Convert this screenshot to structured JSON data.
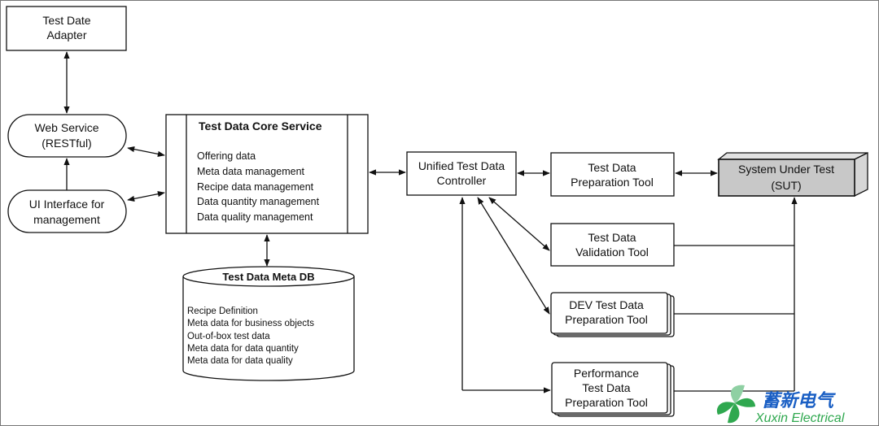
{
  "nodes": {
    "adapter": {
      "lines": [
        "Test Date",
        "Adapter"
      ]
    },
    "web_service": {
      "lines": [
        "Web Service",
        "(RESTful)"
      ]
    },
    "ui_interface": {
      "lines": [
        "UI Interface for",
        "management"
      ]
    },
    "core_service": {
      "title": "Test Data Core Service",
      "items": [
        "Offering data",
        "Meta data management",
        "Recipe data management",
        "Data quantity management",
        "Data quality management"
      ]
    },
    "meta_db": {
      "title": "Test Data Meta DB",
      "items": [
        "Recipe Definition",
        "Meta data for business objects",
        "Out-of-box test data",
        "Meta data for data quantity",
        "Meta data for data quality"
      ]
    },
    "controller": {
      "lines": [
        "Unified Test Data",
        "Controller"
      ]
    },
    "prep_tool": {
      "lines": [
        "Test Data",
        "Preparation Tool"
      ]
    },
    "validation_tool": {
      "lines": [
        "Test Data",
        "Validation Tool"
      ]
    },
    "dev_tool": {
      "lines": [
        "DEV Test Data",
        "Preparation Tool"
      ]
    },
    "perf_tool": {
      "lines": [
        "Performance",
        "Test Data",
        "Preparation Tool"
      ]
    },
    "sut": {
      "lines": [
        "System Under Test",
        "(SUT)"
      ],
      "fill": "#c8c8c8"
    }
  },
  "watermark": {
    "chinese": "蓄新电气",
    "english": "Xuxin Electrical",
    "text_color": "#1a5fc4",
    "leaf_color": "#2fa84f"
  }
}
